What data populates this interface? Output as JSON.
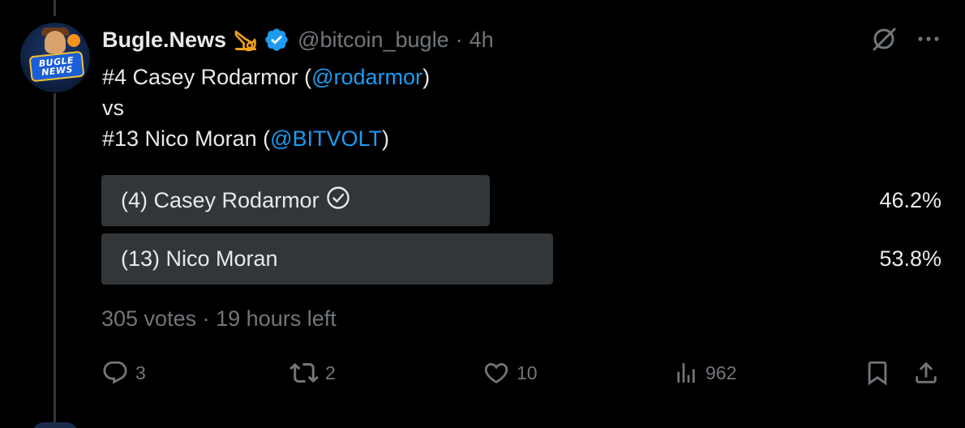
{
  "author": {
    "display_name": "Bugle.News",
    "handle": "@bitcoin_bugle",
    "separator": "·",
    "time": "4h",
    "avatar_text_line1": "BUGLE",
    "avatar_text_line2": "NEWS"
  },
  "tweet": {
    "line1_prefix": "#4 Casey Rodarmor (",
    "line1_mention": "@rodarmor",
    "line1_suffix": ")",
    "line2": "vs",
    "line3_prefix": "#13 Nico Moran (",
    "line3_mention": "@BITVOLT",
    "line3_suffix": ")"
  },
  "poll": {
    "options": [
      {
        "label": "(4) Casey Rodarmor",
        "percent_text": "46.2%",
        "percent": 46.2,
        "leading": false,
        "voted": true
      },
      {
        "label": "(13) Nico Moran",
        "percent_text": "53.8%",
        "percent": 53.8,
        "leading": true,
        "voted": false
      }
    ],
    "votes": "305 votes",
    "separator": "·",
    "time_left": "19 hours left"
  },
  "actions": {
    "replies": "3",
    "reposts": "2",
    "likes": "10",
    "views": "962"
  },
  "icons": {
    "emoji_badge": "horn-icon",
    "verified": "verified-badge-icon",
    "grok": "grok-icon",
    "more": "more-icon",
    "reply": "reply-icon",
    "repost": "repost-icon",
    "like": "heart-icon",
    "views": "views-icon",
    "bookmark": "bookmark-icon",
    "share": "share-icon",
    "voted": "check-circle-icon"
  },
  "colors": {
    "background": "#000000",
    "text": "#e7e9ea",
    "muted": "#71767b",
    "link": "#1d9bf0",
    "poll_bar": "#333639"
  }
}
